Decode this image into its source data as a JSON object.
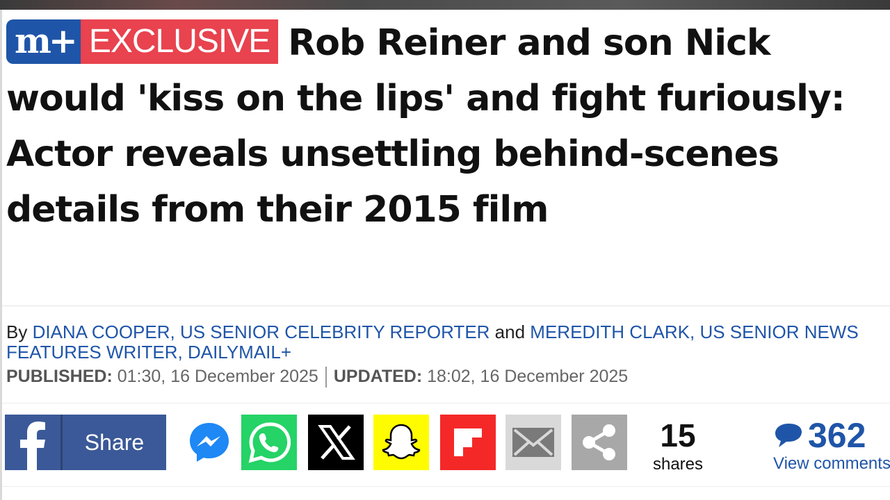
{
  "badge": {
    "mplus": "m+",
    "exclusive": "EXCLUSIVE"
  },
  "headline": "Rob Reiner and son Nick would 'kiss on the lips' and fight furiously: Actor reveals unsettling behind-scenes details from their 2015 film",
  "byline": {
    "by": "By",
    "author1": "DIANA COOPER, US SENIOR CELEBRITY REPORTER",
    "and": "and",
    "author2": "MEREDITH CLARK, US SENIOR NEWS FEATURES WRITER, DAILYMAIL+"
  },
  "dates": {
    "published_label": "PUBLISHED:",
    "published_value": "01:30, 16 December 2025",
    "updated_label": "UPDATED:",
    "updated_value": "18:02, 16 December 2025"
  },
  "share": {
    "facebook_label": "Share",
    "count": "15",
    "count_label": "shares"
  },
  "comments": {
    "count": "362",
    "label": "View comments"
  },
  "colors": {
    "brand_blue": "#1f55a8",
    "exclusive_red": "#e8434e",
    "facebook": "#3b5998",
    "whatsapp": "#25d366",
    "x": "#000000",
    "snapchat": "#fffc00",
    "flipboard": "#f52828"
  },
  "icons": [
    "facebook-icon",
    "messenger-icon",
    "whatsapp-icon",
    "x-icon",
    "snapchat-icon",
    "flipboard-icon",
    "email-icon",
    "share-icon",
    "comment-bubble-icon"
  ]
}
